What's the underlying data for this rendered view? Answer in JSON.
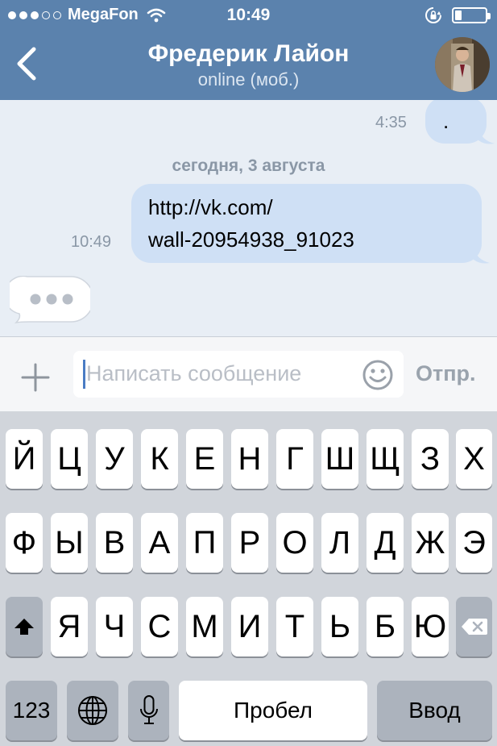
{
  "status_bar": {
    "signal_bars_filled": 3,
    "signal_bars_total": 5,
    "carrier": "MegaFon",
    "time": "10:49",
    "icons": [
      "wifi-icon",
      "rotation-lock-icon",
      "battery-icon"
    ],
    "battery_level": 0.15
  },
  "nav": {
    "back_icon": "chevron-left-icon",
    "title": "Фредерик Лайон",
    "subtitle": "online (моб.)"
  },
  "messages": [
    {
      "direction": "outgoing",
      "text": ".",
      "time": "4:35"
    },
    {
      "direction": "outgoing",
      "text_lines": [
        "http://vk.com/",
        "wall-20954938_91023"
      ],
      "time": "10:49"
    },
    {
      "direction": "incoming",
      "typing_indicator": true
    }
  ],
  "date_separator": "сегодня, 3 августа",
  "composer": {
    "placeholder": "Написать сообщение",
    "send_label": "Отпр.",
    "attach_icon": "plus-icon",
    "emoji_icon": "smiley-icon"
  },
  "keyboard": {
    "row1": [
      "Й",
      "Ц",
      "У",
      "К",
      "Е",
      "Н",
      "Г",
      "Ш",
      "Щ",
      "З",
      "Х"
    ],
    "row2": [
      "Ф",
      "Ы",
      "В",
      "А",
      "П",
      "Р",
      "О",
      "Л",
      "Д",
      "Ж",
      "Э"
    ],
    "row3": [
      "Я",
      "Ч",
      "С",
      "М",
      "И",
      "Т",
      "Ь",
      "Б",
      "Ю"
    ],
    "numbers_label": "123",
    "space_label": "Пробел",
    "return_label": "Ввод",
    "icons": [
      "shift-icon",
      "backspace-icon",
      "globe-icon",
      "microphone-icon"
    ]
  },
  "colors": {
    "header": "#5b82ad",
    "outgoing_bubble": "#cfe0f5",
    "chat_background": "#e8eef5"
  }
}
